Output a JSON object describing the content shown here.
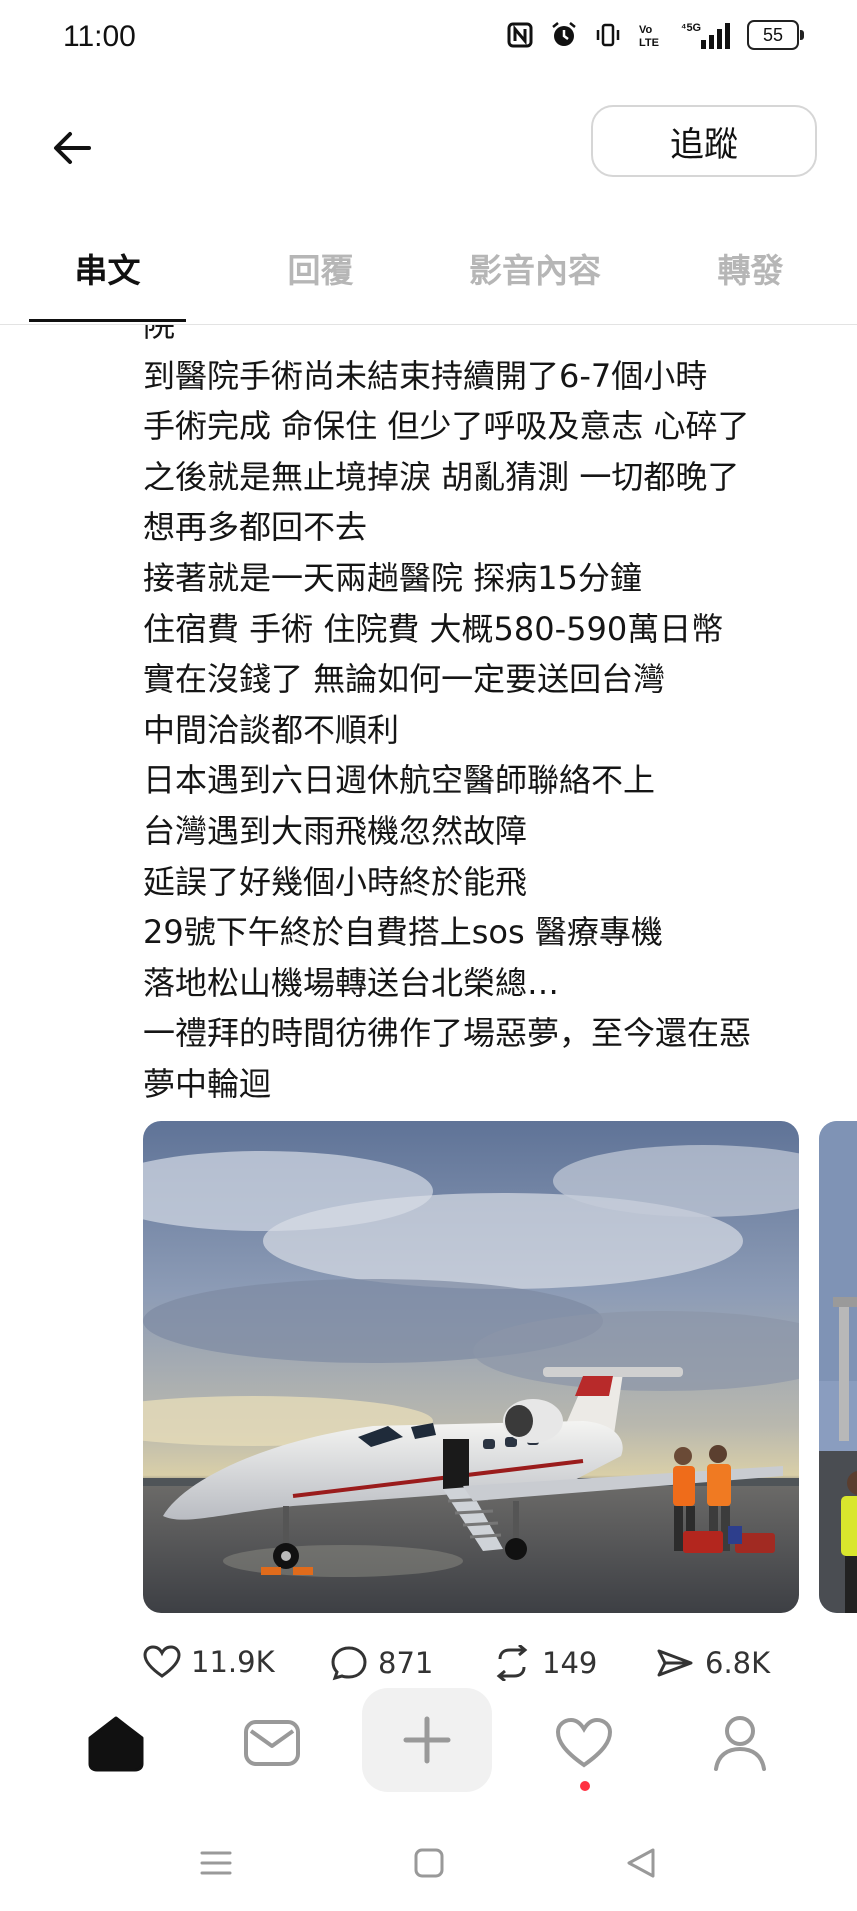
{
  "status_bar": {
    "time": "11:00",
    "icons": [
      "nfc-icon",
      "alarm-icon",
      "vibrate-icon",
      "volte-icon",
      "5g-signal-icon"
    ],
    "battery": "55"
  },
  "header": {
    "back_icon": "arrow-left-icon",
    "follow_label": "追蹤"
  },
  "tabs": [
    {
      "label": "串文",
      "active": true
    },
    {
      "label": "回覆",
      "active": false
    },
    {
      "label": "影音內容",
      "active": false
    },
    {
      "label": "轉發",
      "active": false
    }
  ],
  "post": {
    "lines": [
      "院",
      "到醫院手術尚未結束持續開了6-7個小時",
      "手術完成 命保住 但少了呼吸及意志 心碎了",
      "之後就是無止境掉淚 胡亂猜測  一切都晚了",
      "想再多都回不去",
      "接著就是一天兩趟醫院 探病15分鐘",
      "住宿費 手術 住院費 大概580-590萬日幣",
      "實在沒錢了 無論如何一定要送回台灣",
      "中間洽談都不順利",
      "日本遇到六日週休航空醫師聯絡不上",
      "台灣遇到大雨飛機忽然故障",
      "延誤了好幾個小時終於能飛",
      "29號下午終於自費搭上sos 醫療專機",
      "落地松山機場轉送台北榮總…",
      "一禮拜的時間彷彿作了場惡夢，至今還在惡",
      "夢中輪迴"
    ]
  },
  "actions": {
    "likes": "11.9K",
    "comments": "871",
    "reposts": "149",
    "shares": "6.8K"
  },
  "bottom_nav": {
    "items": [
      "home-icon",
      "inbox-icon",
      "compose-icon",
      "activity-icon",
      "profile-icon"
    ]
  },
  "system_nav": {
    "items": [
      "menu-icon",
      "home-square-icon",
      "back-triangle-icon"
    ]
  }
}
